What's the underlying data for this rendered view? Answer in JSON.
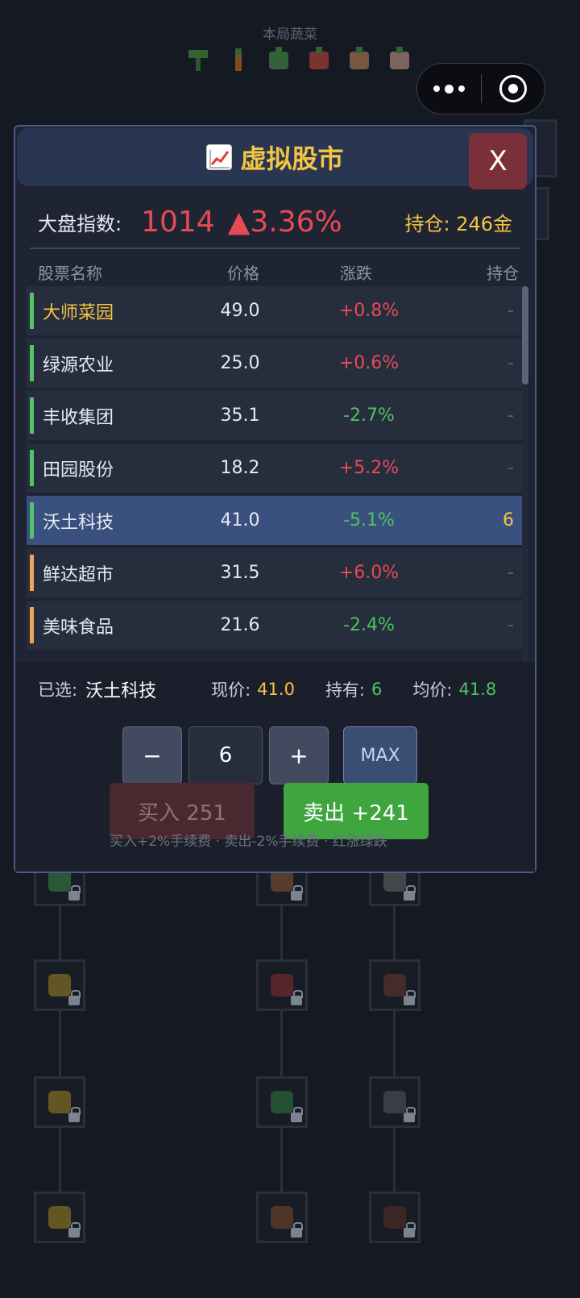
{
  "background": {
    "title": "本局蔬菜"
  },
  "modal": {
    "title": "虚拟股市",
    "close_label": "X",
    "index": {
      "label": "大盘指数:",
      "value": "1014",
      "change": "▲3.36%",
      "holding": "持仓: 246金"
    },
    "columns": {
      "name": "股票名称",
      "price": "价格",
      "change": "涨跌",
      "hold": "持仓"
    },
    "stocks": [
      {
        "name": "大师菜园",
        "price": "49.0",
        "change": "+0.8%",
        "hold": "-",
        "trend": "up",
        "bar": "#55c26a",
        "name_color": "#f4c542"
      },
      {
        "name": "绿源农业",
        "price": "25.0",
        "change": "+0.6%",
        "hold": "-",
        "trend": "up",
        "bar": "#55c26a"
      },
      {
        "name": "丰收集团",
        "price": "35.1",
        "change": "-2.7%",
        "hold": "-",
        "trend": "down",
        "bar": "#55c26a"
      },
      {
        "name": "田园股份",
        "price": "18.2",
        "change": "+5.2%",
        "hold": "-",
        "trend": "up",
        "bar": "#55c26a"
      },
      {
        "name": "沃土科技",
        "price": "41.0",
        "change": "-5.1%",
        "hold": "6",
        "trend": "down",
        "bar": "#55c26a",
        "selected": true
      },
      {
        "name": "鲜达超市",
        "price": "31.5",
        "change": "+6.0%",
        "hold": "-",
        "trend": "up",
        "bar": "#f0a45a"
      },
      {
        "name": "美味食品",
        "price": "21.6",
        "change": "-2.4%",
        "hold": "-",
        "trend": "down",
        "bar": "#f0a45a"
      }
    ],
    "selection": {
      "selected_label": "已选:",
      "selected_name": "沃土科技",
      "price_label": "现价:",
      "price": "41.0",
      "holding_label": "持有:",
      "holding": "6",
      "avg_label": "均价:",
      "avg": "41.8"
    },
    "trade": {
      "minus": "−",
      "quantity": "6",
      "plus": "+",
      "max": "MAX",
      "buy": "买入 251",
      "sell": "卖出 +241",
      "note": "买入+2%手续费 · 卖出-2%手续费 · 红涨绿跌"
    }
  },
  "colors": {
    "up": "#e84a55",
    "down": "#4fc25f",
    "gold": "#f4c542",
    "modal_header": "#2a3552",
    "selected_row": "#3a5180"
  }
}
